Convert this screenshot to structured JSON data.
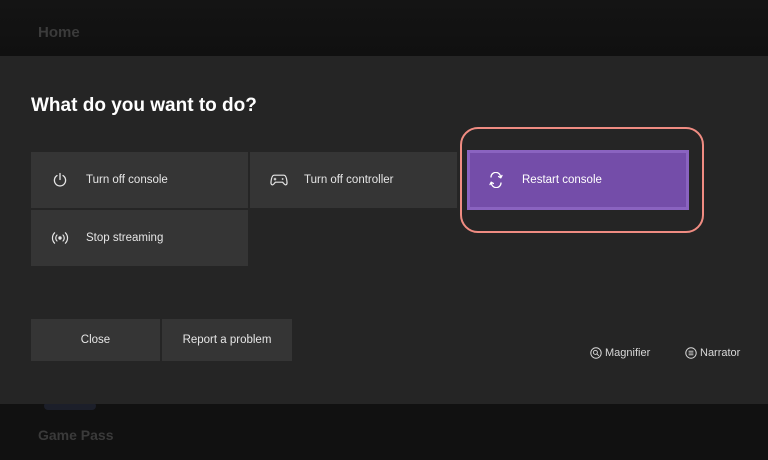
{
  "background": {
    "home_label": "Home",
    "game_pass_label": "Game Pass"
  },
  "dialog": {
    "title": "What do you want to do?",
    "options": [
      {
        "label": "Turn off console",
        "icon": "power-icon"
      },
      {
        "label": "Turn off controller",
        "icon": "controller-icon"
      },
      {
        "label": "Restart console",
        "icon": "restart-icon",
        "selected": true
      },
      {
        "label": "Stop streaming",
        "icon": "streaming-icon"
      }
    ],
    "buttons": {
      "close_label": "Close",
      "report_label": "Report a problem"
    },
    "accessibility": {
      "magnifier_label": "Magnifier",
      "narrator_label": "Narrator"
    }
  },
  "colors": {
    "selected_tile": "#744da9",
    "tile": "#353535",
    "dialog_background": "#252525",
    "highlight_ring": "#f08c82"
  }
}
